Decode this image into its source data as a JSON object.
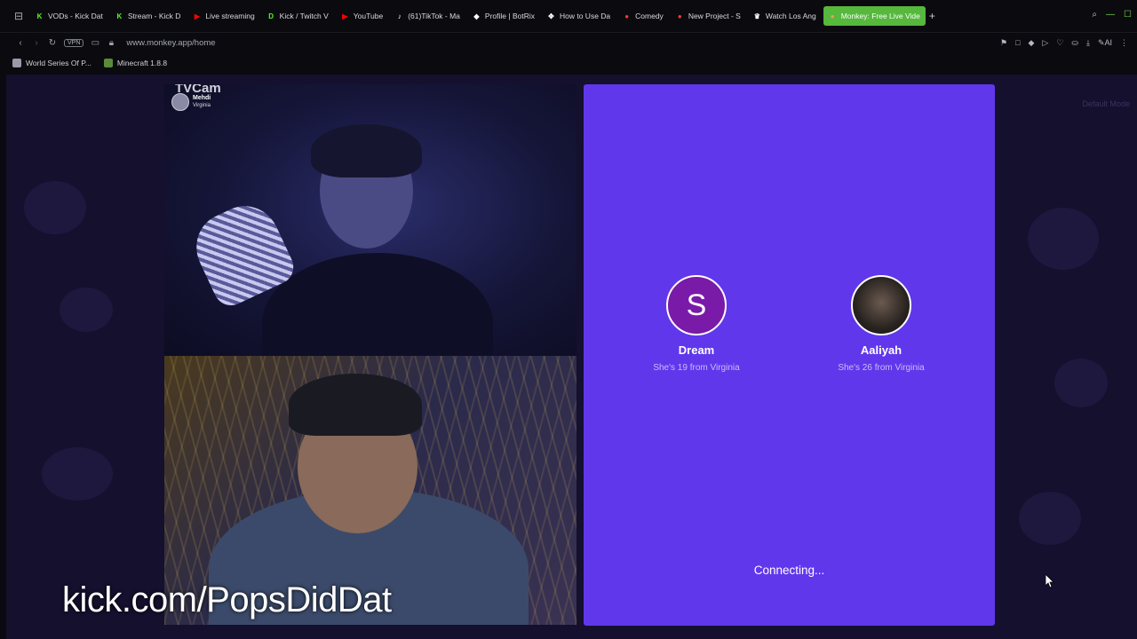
{
  "tabs": [
    {
      "label": "VODs - Kick Dat",
      "fav_color": "#53fc18",
      "fav_glyph": "K",
      "active": false
    },
    {
      "label": "Stream - Kick D",
      "fav_color": "#53fc18",
      "fav_glyph": "K",
      "active": false
    },
    {
      "label": "Live streaming",
      "fav_color": "#ff0000",
      "fav_glyph": "▶",
      "active": false
    },
    {
      "label": "Kick / Twitch V",
      "fav_color": "#53fc18",
      "fav_glyph": "D",
      "active": false
    },
    {
      "label": "YouTube",
      "fav_color": "#ff0000",
      "fav_glyph": "▶",
      "active": false
    },
    {
      "label": "(61)TikTok - Ma",
      "fav_color": "#ffffff",
      "fav_glyph": "♪",
      "active": false
    },
    {
      "label": "Profile | BotRix",
      "fav_color": "#ffffff",
      "fav_glyph": "◆",
      "active": false
    },
    {
      "label": "How to Use Da",
      "fav_color": "#ffffff",
      "fav_glyph": "✥",
      "active": false
    },
    {
      "label": "Comedy",
      "fav_color": "#ff3b30",
      "fav_glyph": "●",
      "active": false
    },
    {
      "label": "New Project - S",
      "fav_color": "#ff3b30",
      "fav_glyph": "●",
      "active": false
    },
    {
      "label": "Watch Los Ang",
      "fav_color": "#ffffff",
      "fav_glyph": "♛",
      "active": false
    },
    {
      "label": "Monkey: Free Live Vide",
      "fav_color": "#f0a050",
      "fav_glyph": "●",
      "active": true
    }
  ],
  "address": {
    "vpn": "VPN",
    "url": "www.monkey.app/home"
  },
  "bookmarks": [
    {
      "label": "World Series Of P...",
      "fav_color": "#9a9aa8"
    },
    {
      "label": "Minecraft 1.8.8",
      "fav_color": "#5a8a3a"
    }
  ],
  "page": {
    "default_mode": "Default Mode",
    "top_video": {
      "overlay_text": "TVCam",
      "user_name": "Mehdi",
      "user_location": "Virginia"
    },
    "candidates": [
      {
        "initial": "S",
        "name": "Dream",
        "desc": "She's 19 from Virginia",
        "avatar_color": "#7a1aa8"
      },
      {
        "initial": "",
        "name": "Aaliyah",
        "desc": "She's 26 from Virginia",
        "avatar_color": "#2a2a2a"
      }
    ],
    "status": "Connecting..."
  },
  "overlay": {
    "watermark": "kick.com/PopsDidDat"
  },
  "colors": {
    "match_panel": "#6137ec",
    "active_tab": "#56b83c",
    "page_bg": "#14102e"
  }
}
